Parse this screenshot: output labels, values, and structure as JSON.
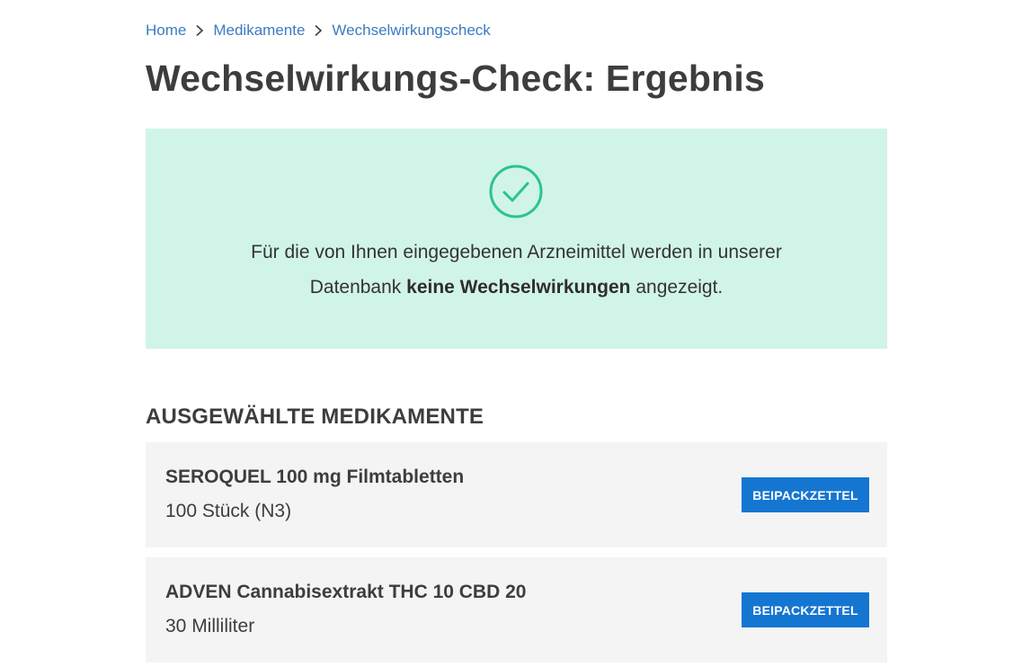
{
  "breadcrumb": {
    "items": [
      "Home",
      "Medikamente",
      "Wechselwirkungscheck"
    ]
  },
  "page_title": "Wechselwirkungs-Check: Ergebnis",
  "result": {
    "icon": "check-circle-icon",
    "line1": "Für die von Ihnen eingegebenen Arzneimittel werden in unserer",
    "line2_before": "Datenbank ",
    "line2_bold": "keine Wechselwirkungen",
    "line2_after": " angezeigt.",
    "background_color": "#d1f4e8",
    "icon_color": "#2bc48a"
  },
  "section_heading": "AUSGEWÄHLTE MEDIKAMENTE",
  "medications": [
    {
      "name": "SEROQUEL 100 mg Filmtabletten",
      "quantity": "100 Stück (N3)",
      "button_label": "BEIPACKZETTEL"
    },
    {
      "name": "ADVEN Cannabisextrakt THC 10 CBD 20",
      "quantity": "30 Milliliter",
      "button_label": "BEIPACKZETTEL"
    }
  ],
  "colors": {
    "link": "#3a7cc1",
    "button": "#1576d2",
    "card_background": "#f4f4f4"
  }
}
